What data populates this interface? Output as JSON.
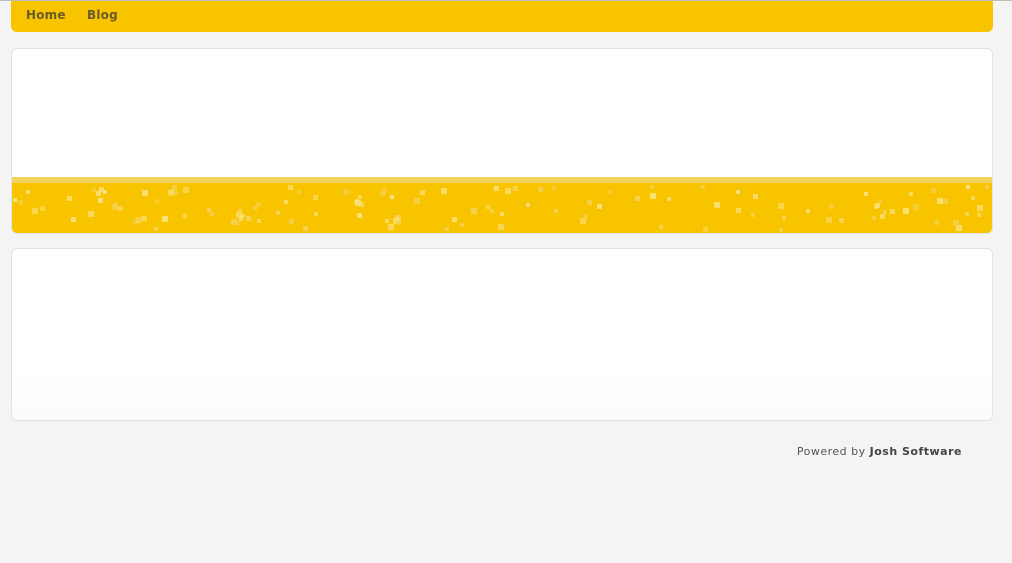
{
  "nav": {
    "items": [
      {
        "label": "Home"
      },
      {
        "label": "Blog"
      }
    ]
  },
  "footer": {
    "prefix": "Powered by",
    "brand": "Josh Software"
  },
  "colors": {
    "accent": "#f8c400",
    "background": "#f4f4f4",
    "panel": "#ffffff"
  }
}
